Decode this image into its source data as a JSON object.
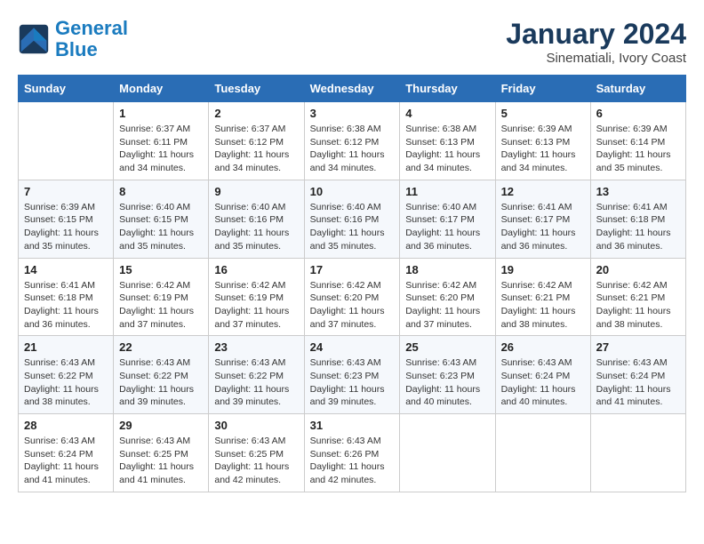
{
  "header": {
    "logo_line1": "General",
    "logo_line2": "Blue",
    "month": "January 2024",
    "location": "Sinematiali, Ivory Coast"
  },
  "days_of_week": [
    "Sunday",
    "Monday",
    "Tuesday",
    "Wednesday",
    "Thursday",
    "Friday",
    "Saturday"
  ],
  "weeks": [
    [
      {
        "day": "",
        "info": ""
      },
      {
        "day": "1",
        "info": "Sunrise: 6:37 AM\nSunset: 6:11 PM\nDaylight: 11 hours and 34 minutes."
      },
      {
        "day": "2",
        "info": "Sunrise: 6:37 AM\nSunset: 6:12 PM\nDaylight: 11 hours and 34 minutes."
      },
      {
        "day": "3",
        "info": "Sunrise: 6:38 AM\nSunset: 6:12 PM\nDaylight: 11 hours and 34 minutes."
      },
      {
        "day": "4",
        "info": "Sunrise: 6:38 AM\nSunset: 6:13 PM\nDaylight: 11 hours and 34 minutes."
      },
      {
        "day": "5",
        "info": "Sunrise: 6:39 AM\nSunset: 6:13 PM\nDaylight: 11 hours and 34 minutes."
      },
      {
        "day": "6",
        "info": "Sunrise: 6:39 AM\nSunset: 6:14 PM\nDaylight: 11 hours and 35 minutes."
      }
    ],
    [
      {
        "day": "7",
        "info": "Sunrise: 6:39 AM\nSunset: 6:15 PM\nDaylight: 11 hours and 35 minutes."
      },
      {
        "day": "8",
        "info": "Sunrise: 6:40 AM\nSunset: 6:15 PM\nDaylight: 11 hours and 35 minutes."
      },
      {
        "day": "9",
        "info": "Sunrise: 6:40 AM\nSunset: 6:16 PM\nDaylight: 11 hours and 35 minutes."
      },
      {
        "day": "10",
        "info": "Sunrise: 6:40 AM\nSunset: 6:16 PM\nDaylight: 11 hours and 35 minutes."
      },
      {
        "day": "11",
        "info": "Sunrise: 6:40 AM\nSunset: 6:17 PM\nDaylight: 11 hours and 36 minutes."
      },
      {
        "day": "12",
        "info": "Sunrise: 6:41 AM\nSunset: 6:17 PM\nDaylight: 11 hours and 36 minutes."
      },
      {
        "day": "13",
        "info": "Sunrise: 6:41 AM\nSunset: 6:18 PM\nDaylight: 11 hours and 36 minutes."
      }
    ],
    [
      {
        "day": "14",
        "info": "Sunrise: 6:41 AM\nSunset: 6:18 PM\nDaylight: 11 hours and 36 minutes."
      },
      {
        "day": "15",
        "info": "Sunrise: 6:42 AM\nSunset: 6:19 PM\nDaylight: 11 hours and 37 minutes."
      },
      {
        "day": "16",
        "info": "Sunrise: 6:42 AM\nSunset: 6:19 PM\nDaylight: 11 hours and 37 minutes."
      },
      {
        "day": "17",
        "info": "Sunrise: 6:42 AM\nSunset: 6:20 PM\nDaylight: 11 hours and 37 minutes."
      },
      {
        "day": "18",
        "info": "Sunrise: 6:42 AM\nSunset: 6:20 PM\nDaylight: 11 hours and 37 minutes."
      },
      {
        "day": "19",
        "info": "Sunrise: 6:42 AM\nSunset: 6:21 PM\nDaylight: 11 hours and 38 minutes."
      },
      {
        "day": "20",
        "info": "Sunrise: 6:42 AM\nSunset: 6:21 PM\nDaylight: 11 hours and 38 minutes."
      }
    ],
    [
      {
        "day": "21",
        "info": "Sunrise: 6:43 AM\nSunset: 6:22 PM\nDaylight: 11 hours and 38 minutes."
      },
      {
        "day": "22",
        "info": "Sunrise: 6:43 AM\nSunset: 6:22 PM\nDaylight: 11 hours and 39 minutes."
      },
      {
        "day": "23",
        "info": "Sunrise: 6:43 AM\nSunset: 6:22 PM\nDaylight: 11 hours and 39 minutes."
      },
      {
        "day": "24",
        "info": "Sunrise: 6:43 AM\nSunset: 6:23 PM\nDaylight: 11 hours and 39 minutes."
      },
      {
        "day": "25",
        "info": "Sunrise: 6:43 AM\nSunset: 6:23 PM\nDaylight: 11 hours and 40 minutes."
      },
      {
        "day": "26",
        "info": "Sunrise: 6:43 AM\nSunset: 6:24 PM\nDaylight: 11 hours and 40 minutes."
      },
      {
        "day": "27",
        "info": "Sunrise: 6:43 AM\nSunset: 6:24 PM\nDaylight: 11 hours and 41 minutes."
      }
    ],
    [
      {
        "day": "28",
        "info": "Sunrise: 6:43 AM\nSunset: 6:24 PM\nDaylight: 11 hours and 41 minutes."
      },
      {
        "day": "29",
        "info": "Sunrise: 6:43 AM\nSunset: 6:25 PM\nDaylight: 11 hours and 41 minutes."
      },
      {
        "day": "30",
        "info": "Sunrise: 6:43 AM\nSunset: 6:25 PM\nDaylight: 11 hours and 42 minutes."
      },
      {
        "day": "31",
        "info": "Sunrise: 6:43 AM\nSunset: 6:26 PM\nDaylight: 11 hours and 42 minutes."
      },
      {
        "day": "",
        "info": ""
      },
      {
        "day": "",
        "info": ""
      },
      {
        "day": "",
        "info": ""
      }
    ]
  ]
}
